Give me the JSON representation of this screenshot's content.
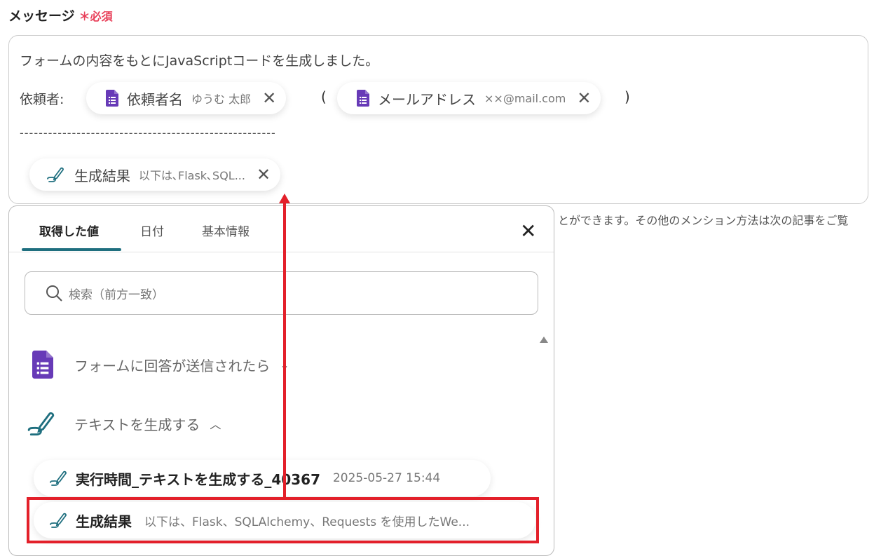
{
  "field": {
    "label": "メッセージ",
    "required_mark": "＊",
    "required": "必須"
  },
  "message": {
    "line1": "フォームの内容をもとにJavaScriptコードを生成しました。",
    "requester_label": "依頼者:",
    "chip_name": {
      "key": "依頼者名",
      "value": "ゆうむ 太郎",
      "icon": "google-forms-icon"
    },
    "open_paren": "(",
    "chip_email": {
      "key": "メールアドレス",
      "value": "××@mail.com",
      "icon": "google-forms-icon"
    },
    "close_paren": ")",
    "divider": "------------------------------------------------------",
    "chip_result": {
      "key": "生成結果",
      "value": "以下は､Flask､SQL...",
      "icon": "ai-pen-icon"
    }
  },
  "help_text": "とができます。その他のメンション方法は次の記事をご覧",
  "popup": {
    "tabs": [
      {
        "label": "取得した値",
        "active": true
      },
      {
        "label": "日付"
      },
      {
        "label": "基本情報"
      }
    ],
    "search_placeholder": "検索（前方一致）",
    "sections": [
      {
        "label": "フォームに回答が送信されたら",
        "expanded": false,
        "icon": "google-forms-icon"
      },
      {
        "label": "テキストを生成する",
        "expanded": true,
        "icon": "ai-pen-icon"
      }
    ],
    "items": [
      {
        "key": "実行時間_テキストを生成する_40367",
        "value": "2025-05-27 15:44"
      },
      {
        "key": "生成結果",
        "value": "以下は、Flask、SQLAlchemy、Requests を使用したWe...",
        "highlighted": true
      }
    ]
  },
  "colors": {
    "accent": "#1f6f7f",
    "forms": "#673ab7",
    "highlight": "#e3202a",
    "required": "#e8405a"
  }
}
